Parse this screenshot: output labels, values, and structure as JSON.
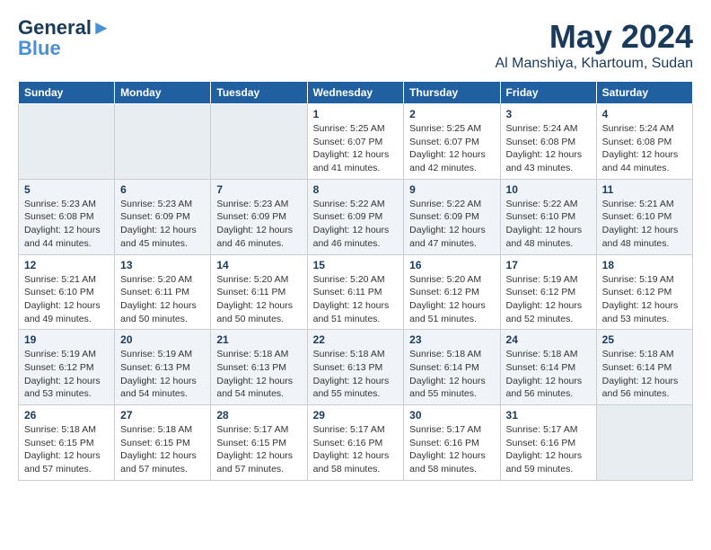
{
  "header": {
    "logo_line1": "General",
    "logo_line2": "Blue",
    "month_title": "May 2024",
    "location": "Al Manshiya, Khartoum, Sudan"
  },
  "days_of_week": [
    "Sunday",
    "Monday",
    "Tuesday",
    "Wednesday",
    "Thursday",
    "Friday",
    "Saturday"
  ],
  "weeks": [
    [
      {
        "day": "",
        "info": ""
      },
      {
        "day": "",
        "info": ""
      },
      {
        "day": "",
        "info": ""
      },
      {
        "day": "1",
        "info": "Sunrise: 5:25 AM\nSunset: 6:07 PM\nDaylight: 12 hours\nand 41 minutes."
      },
      {
        "day": "2",
        "info": "Sunrise: 5:25 AM\nSunset: 6:07 PM\nDaylight: 12 hours\nand 42 minutes."
      },
      {
        "day": "3",
        "info": "Sunrise: 5:24 AM\nSunset: 6:08 PM\nDaylight: 12 hours\nand 43 minutes."
      },
      {
        "day": "4",
        "info": "Sunrise: 5:24 AM\nSunset: 6:08 PM\nDaylight: 12 hours\nand 44 minutes."
      }
    ],
    [
      {
        "day": "5",
        "info": "Sunrise: 5:23 AM\nSunset: 6:08 PM\nDaylight: 12 hours\nand 44 minutes."
      },
      {
        "day": "6",
        "info": "Sunrise: 5:23 AM\nSunset: 6:09 PM\nDaylight: 12 hours\nand 45 minutes."
      },
      {
        "day": "7",
        "info": "Sunrise: 5:23 AM\nSunset: 6:09 PM\nDaylight: 12 hours\nand 46 minutes."
      },
      {
        "day": "8",
        "info": "Sunrise: 5:22 AM\nSunset: 6:09 PM\nDaylight: 12 hours\nand 46 minutes."
      },
      {
        "day": "9",
        "info": "Sunrise: 5:22 AM\nSunset: 6:09 PM\nDaylight: 12 hours\nand 47 minutes."
      },
      {
        "day": "10",
        "info": "Sunrise: 5:22 AM\nSunset: 6:10 PM\nDaylight: 12 hours\nand 48 minutes."
      },
      {
        "day": "11",
        "info": "Sunrise: 5:21 AM\nSunset: 6:10 PM\nDaylight: 12 hours\nand 48 minutes."
      }
    ],
    [
      {
        "day": "12",
        "info": "Sunrise: 5:21 AM\nSunset: 6:10 PM\nDaylight: 12 hours\nand 49 minutes."
      },
      {
        "day": "13",
        "info": "Sunrise: 5:20 AM\nSunset: 6:11 PM\nDaylight: 12 hours\nand 50 minutes."
      },
      {
        "day": "14",
        "info": "Sunrise: 5:20 AM\nSunset: 6:11 PM\nDaylight: 12 hours\nand 50 minutes."
      },
      {
        "day": "15",
        "info": "Sunrise: 5:20 AM\nSunset: 6:11 PM\nDaylight: 12 hours\nand 51 minutes."
      },
      {
        "day": "16",
        "info": "Sunrise: 5:20 AM\nSunset: 6:12 PM\nDaylight: 12 hours\nand 51 minutes."
      },
      {
        "day": "17",
        "info": "Sunrise: 5:19 AM\nSunset: 6:12 PM\nDaylight: 12 hours\nand 52 minutes."
      },
      {
        "day": "18",
        "info": "Sunrise: 5:19 AM\nSunset: 6:12 PM\nDaylight: 12 hours\nand 53 minutes."
      }
    ],
    [
      {
        "day": "19",
        "info": "Sunrise: 5:19 AM\nSunset: 6:12 PM\nDaylight: 12 hours\nand 53 minutes."
      },
      {
        "day": "20",
        "info": "Sunrise: 5:19 AM\nSunset: 6:13 PM\nDaylight: 12 hours\nand 54 minutes."
      },
      {
        "day": "21",
        "info": "Sunrise: 5:18 AM\nSunset: 6:13 PM\nDaylight: 12 hours\nand 54 minutes."
      },
      {
        "day": "22",
        "info": "Sunrise: 5:18 AM\nSunset: 6:13 PM\nDaylight: 12 hours\nand 55 minutes."
      },
      {
        "day": "23",
        "info": "Sunrise: 5:18 AM\nSunset: 6:14 PM\nDaylight: 12 hours\nand 55 minutes."
      },
      {
        "day": "24",
        "info": "Sunrise: 5:18 AM\nSunset: 6:14 PM\nDaylight: 12 hours\nand 56 minutes."
      },
      {
        "day": "25",
        "info": "Sunrise: 5:18 AM\nSunset: 6:14 PM\nDaylight: 12 hours\nand 56 minutes."
      }
    ],
    [
      {
        "day": "26",
        "info": "Sunrise: 5:18 AM\nSunset: 6:15 PM\nDaylight: 12 hours\nand 57 minutes."
      },
      {
        "day": "27",
        "info": "Sunrise: 5:18 AM\nSunset: 6:15 PM\nDaylight: 12 hours\nand 57 minutes."
      },
      {
        "day": "28",
        "info": "Sunrise: 5:17 AM\nSunset: 6:15 PM\nDaylight: 12 hours\nand 57 minutes."
      },
      {
        "day": "29",
        "info": "Sunrise: 5:17 AM\nSunset: 6:16 PM\nDaylight: 12 hours\nand 58 minutes."
      },
      {
        "day": "30",
        "info": "Sunrise: 5:17 AM\nSunset: 6:16 PM\nDaylight: 12 hours\nand 58 minutes."
      },
      {
        "day": "31",
        "info": "Sunrise: 5:17 AM\nSunset: 6:16 PM\nDaylight: 12 hours\nand 59 minutes."
      },
      {
        "day": "",
        "info": ""
      }
    ]
  ]
}
